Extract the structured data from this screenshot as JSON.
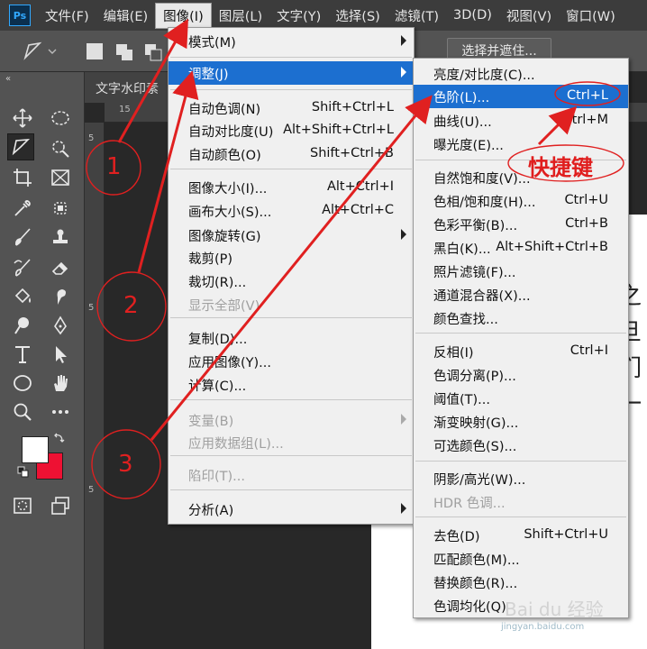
{
  "app": {
    "logo": "Ps"
  },
  "menubar": {
    "items": [
      "文件(F)",
      "编辑(E)",
      "图像(I)",
      "图层(L)",
      "文字(Y)",
      "选择(S)",
      "滤镜(T)",
      "3D(D)",
      "视图(V)",
      "窗口(W)"
    ],
    "active_index": 2
  },
  "options_bar": {
    "select_mask_label": "选择并遮住..."
  },
  "toolbar": {
    "collapse_label": "«",
    "fg_color": "#ffffff",
    "bg_color": "#ee1133"
  },
  "document": {
    "tab_title": "文字水印素",
    "ruler_top_numbers": [
      "15"
    ],
    "ruler_left_numbers": [
      "5",
      "5",
      "5"
    ],
    "canvas_glyphs": [
      "之",
      "旦",
      "们",
      "一"
    ]
  },
  "image_menu": {
    "items": [
      {
        "label": "模式(M)",
        "shortcut": "",
        "submenu": true,
        "disabled": false,
        "highlighted": false
      },
      {
        "label": "调整(J)",
        "shortcut": "",
        "submenu": true,
        "disabled": false,
        "highlighted": true
      },
      {
        "label": "自动色调(N)",
        "shortcut": "Shift+Ctrl+L",
        "submenu": false,
        "disabled": false,
        "highlighted": false
      },
      {
        "label": "自动对比度(U)",
        "shortcut": "Alt+Shift+Ctrl+L",
        "submenu": false,
        "disabled": false,
        "highlighted": false
      },
      {
        "label": "自动颜色(O)",
        "shortcut": "Shift+Ctrl+B",
        "submenu": false,
        "disabled": false,
        "highlighted": false
      },
      {
        "label": "图像大小(I)...",
        "shortcut": "Alt+Ctrl+I",
        "submenu": false,
        "disabled": false,
        "highlighted": false
      },
      {
        "label": "画布大小(S)...",
        "shortcut": "Alt+Ctrl+C",
        "submenu": false,
        "disabled": false,
        "highlighted": false
      },
      {
        "label": "图像旋转(G)",
        "shortcut": "",
        "submenu": true,
        "disabled": false,
        "highlighted": false
      },
      {
        "label": "裁剪(P)",
        "shortcut": "",
        "submenu": false,
        "disabled": false,
        "highlighted": false
      },
      {
        "label": "裁切(R)...",
        "shortcut": "",
        "submenu": false,
        "disabled": false,
        "highlighted": false
      },
      {
        "label": "显示全部(V)",
        "shortcut": "",
        "submenu": false,
        "disabled": true,
        "highlighted": false
      },
      {
        "label": "复制(D)...",
        "shortcut": "",
        "submenu": false,
        "disabled": false,
        "highlighted": false
      },
      {
        "label": "应用图像(Y)...",
        "shortcut": "",
        "submenu": false,
        "disabled": false,
        "highlighted": false
      },
      {
        "label": "计算(C)...",
        "shortcut": "",
        "submenu": false,
        "disabled": false,
        "highlighted": false
      },
      {
        "label": "变量(B)",
        "shortcut": "",
        "submenu": true,
        "disabled": true,
        "highlighted": false
      },
      {
        "label": "应用数据组(L)...",
        "shortcut": "",
        "submenu": false,
        "disabled": true,
        "highlighted": false
      },
      {
        "label": "陷印(T)...",
        "shortcut": "",
        "submenu": false,
        "disabled": true,
        "highlighted": false
      },
      {
        "label": "分析(A)",
        "shortcut": "",
        "submenu": true,
        "disabled": false,
        "highlighted": false
      }
    ]
  },
  "adjust_menu": {
    "items": [
      {
        "label": "亮度/对比度(C)...",
        "shortcut": "",
        "disabled": false,
        "highlighted": false
      },
      {
        "label": "色阶(L)...",
        "shortcut": "Ctrl+L",
        "disabled": false,
        "highlighted": true
      },
      {
        "label": "曲线(U)...",
        "shortcut": "Ctrl+M",
        "disabled": false,
        "highlighted": false
      },
      {
        "label": "曝光度(E)...",
        "shortcut": "",
        "disabled": false,
        "highlighted": false
      },
      {
        "label": "自然饱和度(V)...",
        "shortcut": "",
        "disabled": false,
        "highlighted": false
      },
      {
        "label": "色相/饱和度(H)...",
        "shortcut": "Ctrl+U",
        "disabled": false,
        "highlighted": false
      },
      {
        "label": "色彩平衡(B)...",
        "shortcut": "Ctrl+B",
        "disabled": false,
        "highlighted": false
      },
      {
        "label": "黑白(K)...",
        "shortcut": "Alt+Shift+Ctrl+B",
        "disabled": false,
        "highlighted": false
      },
      {
        "label": "照片滤镜(F)...",
        "shortcut": "",
        "disabled": false,
        "highlighted": false
      },
      {
        "label": "通道混合器(X)...",
        "shortcut": "",
        "disabled": false,
        "highlighted": false
      },
      {
        "label": "颜色查找...",
        "shortcut": "",
        "disabled": false,
        "highlighted": false
      },
      {
        "label": "反相(I)",
        "shortcut": "Ctrl+I",
        "disabled": false,
        "highlighted": false
      },
      {
        "label": "色调分离(P)...",
        "shortcut": "",
        "disabled": false,
        "highlighted": false
      },
      {
        "label": "阈值(T)...",
        "shortcut": "",
        "disabled": false,
        "highlighted": false
      },
      {
        "label": "渐变映射(G)...",
        "shortcut": "",
        "disabled": false,
        "highlighted": false
      },
      {
        "label": "可选颜色(S)...",
        "shortcut": "",
        "disabled": false,
        "highlighted": false
      },
      {
        "label": "阴影/高光(W)...",
        "shortcut": "",
        "disabled": false,
        "highlighted": false
      },
      {
        "label": "HDR 色调...",
        "shortcut": "",
        "disabled": true,
        "highlighted": false
      },
      {
        "label": "去色(D)",
        "shortcut": "Shift+Ctrl+U",
        "disabled": false,
        "highlighted": false
      },
      {
        "label": "匹配颜色(M)...",
        "shortcut": "",
        "disabled": false,
        "highlighted": false
      },
      {
        "label": "替换颜色(R)...",
        "shortcut": "",
        "disabled": false,
        "highlighted": false
      },
      {
        "label": "色调均化(Q)",
        "shortcut": "",
        "disabled": false,
        "highlighted": false
      }
    ]
  },
  "annotations": {
    "steps": [
      "1",
      "2",
      "3"
    ],
    "shortcut_label": "快捷键",
    "color": "#e02020"
  },
  "watermark": {
    "logo": "Bai du 经验",
    "url": "jingyan.baidu.com"
  }
}
